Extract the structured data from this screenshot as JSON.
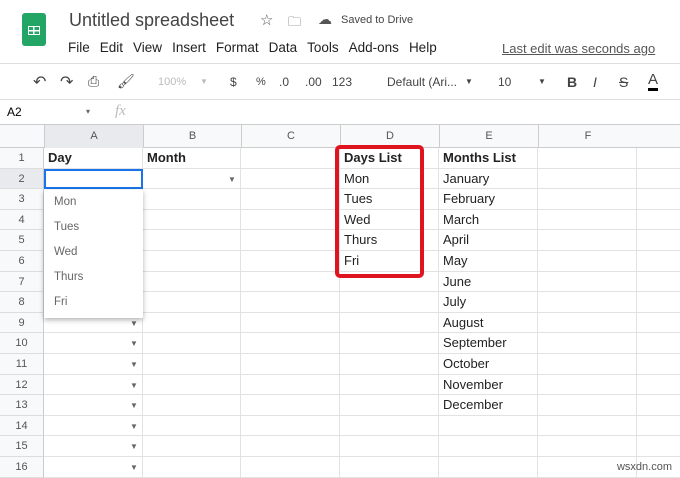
{
  "app": {
    "title": "Untitled spreadsheet",
    "saved": "Saved to Drive",
    "last_edit": "Last edit was seconds ago"
  },
  "menu": [
    "File",
    "Edit",
    "View",
    "Insert",
    "Format",
    "Data",
    "Tools",
    "Add-ons",
    "Help"
  ],
  "toolbar": {
    "zoom": "100%",
    "currency": "$",
    "percent": "%",
    "dec_less": ".0",
    "dec_more": ".00",
    "format": "123",
    "font": "Default (Ari...",
    "size": "10",
    "bold": "B",
    "italic": "I",
    "strike": "S",
    "textcolor": "A"
  },
  "formula": {
    "cell_ref": "A2",
    "fx": "fx"
  },
  "columns": [
    "A",
    "B",
    "C",
    "D",
    "E",
    "F"
  ],
  "rows": [
    "1",
    "2",
    "3",
    "4",
    "5",
    "6",
    "7",
    "8",
    "9",
    "10",
    "11",
    "12",
    "13",
    "14",
    "15",
    "16"
  ],
  "cells": {
    "A1": "Day",
    "B1": "Month",
    "D1": "Days List",
    "E1": "Months List"
  },
  "days": [
    "Mon",
    "Tues",
    "Wed",
    "Thurs",
    "Fri"
  ],
  "months": [
    "January",
    "February",
    "March",
    "April",
    "May",
    "June",
    "July",
    "August",
    "September",
    "October",
    "November",
    "December"
  ],
  "dropdown_options": [
    "Mon",
    "Tues",
    "Wed",
    "Thurs",
    "Fri"
  ],
  "watermark": "wsxdn.com"
}
